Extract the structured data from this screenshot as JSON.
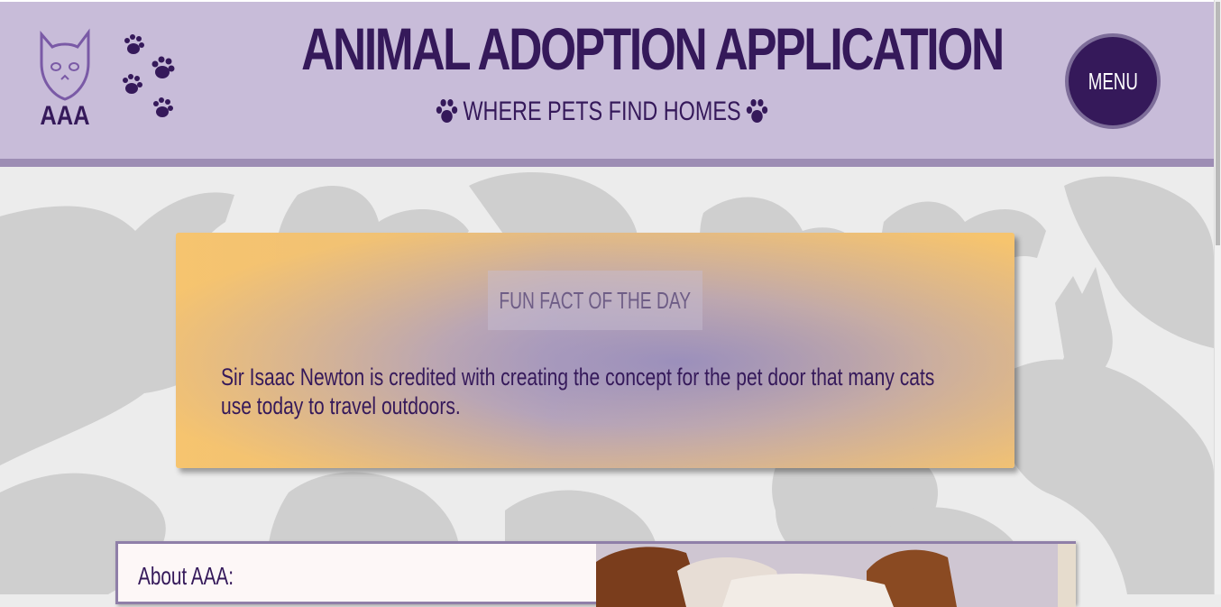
{
  "header": {
    "logo_text": "AAA",
    "title": "ANIMAL ADOPTION APPLICATION",
    "tagline": "WHERE PETS FIND HOMES",
    "menu_label": "MENU"
  },
  "fun_fact": {
    "heading": "FUN FACT OF THE DAY",
    "text": "Sir Isaac Newton is credited with creating the concept for the pet door that many cats use today to travel outdoors."
  },
  "about": {
    "title": "About AAA:"
  },
  "colors": {
    "primary": "#35195a",
    "header_bg": "#c8bcd9",
    "header_rule": "#9d8db4",
    "card_gold": "#f6c36d",
    "card_lavender": "#968cbe"
  },
  "icons": [
    "cat-logo-icon",
    "paw-prints-icon",
    "paw-icon",
    "menu-button"
  ]
}
